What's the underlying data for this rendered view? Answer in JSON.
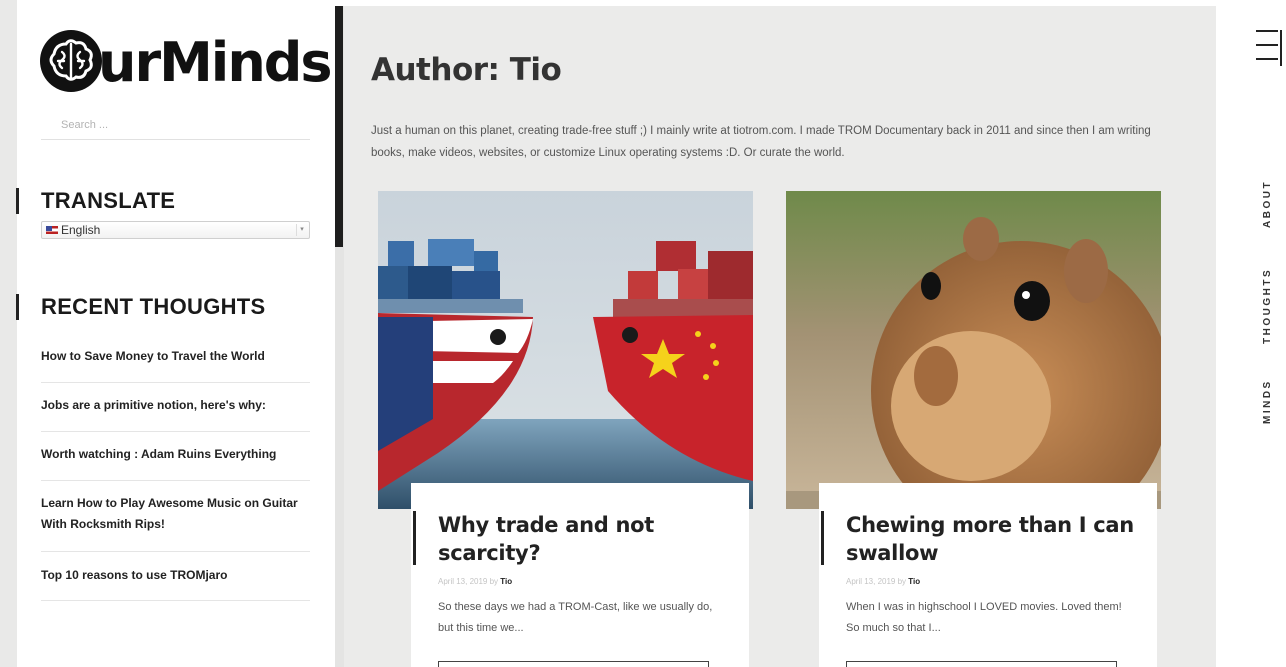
{
  "logo": {
    "text": "urMinds"
  },
  "search": {
    "placeholder": "Search ..."
  },
  "translate": {
    "title": "TRANSLATE",
    "selected_language": "English",
    "options": [
      "English"
    ]
  },
  "recent": {
    "title": "RECENT THOUGHTS",
    "items": [
      "How to Save Money to Travel the World",
      "Jobs are a primitive notion, here's why:",
      "Worth watching : Adam Ruins Everything",
      "Learn How to Play Awesome Music on Guitar With Rocksmith Rips!",
      "Top 10 reasons to use TROMjaro"
    ]
  },
  "main": {
    "title": "Author: Tio",
    "bio": "Just a human on this planet, creating trade-free stuff ;) I mainly write at tiotrom.com. I made TROM Documentary back in 2011 and since then I am writing books, make videos, websites, or customize Linux operating systems :D. Or curate the world.",
    "posts": [
      {
        "title": "Why trade and not scarcity?",
        "date": "April 13, 2019",
        "by": "by",
        "author": "Tio",
        "excerpt": "So these days we had a TROM-Cast, like we usually do, but this time we...",
        "image": "cargo-ships-usa-china"
      },
      {
        "title": "Chewing more than I can swallow",
        "date": "April 13, 2019",
        "by": "by",
        "author": "Tio",
        "excerpt": "When I was in highschool I LOVED movies. Loved them! So much so that I...",
        "image": "chipmunk"
      }
    ]
  },
  "nav": {
    "menu_icon": "hamburger-menu-icon",
    "items": [
      "ABOUT",
      "THOUGHTS",
      "MINDS"
    ]
  }
}
